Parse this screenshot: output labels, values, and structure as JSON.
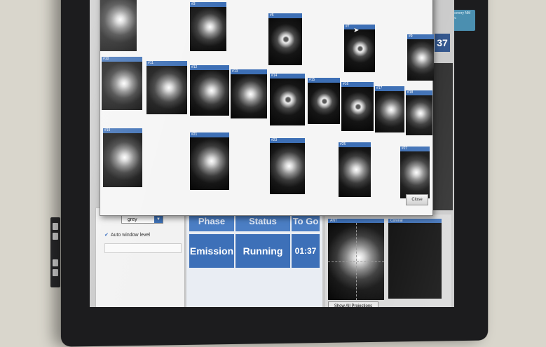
{
  "monitor": {
    "brand_badge": "Discovery NM 530c"
  },
  "background_app": {
    "colormap_select": "grey",
    "auto_window_level_label": "Auto window level",
    "side_counter": "37",
    "status_table": {
      "headers": [
        "Phase",
        "Status",
        "To Go"
      ],
      "row": [
        "Emission",
        "Running",
        "01:37"
      ]
    },
    "views": [
      "ANT",
      "Coronal"
    ],
    "show_projections_button": "Show All Projections"
  },
  "projections_dialog": {
    "tiles": [
      {
        "label": "#3",
        "style": "blob"
      },
      {
        "label": "#5",
        "style": "ring"
      },
      {
        "label": "#7",
        "style": "ring"
      },
      {
        "label": "#9",
        "style": "blob"
      },
      {
        "label": "#10",
        "style": "blob"
      },
      {
        "label": "#11",
        "style": "blob"
      },
      {
        "label": "#12",
        "style": "blob"
      },
      {
        "label": "#13",
        "style": "blob"
      },
      {
        "label": "#14",
        "style": "ring"
      },
      {
        "label": "#15",
        "style": "ring"
      },
      {
        "label": "#16",
        "style": "ring"
      },
      {
        "label": "#17",
        "style": "blob"
      },
      {
        "label": "#18",
        "style": "blob"
      },
      {
        "label": "#19",
        "style": "blob"
      },
      {
        "label": "#21",
        "style": "blob"
      },
      {
        "label": "#23",
        "style": "blob"
      },
      {
        "label": "#25",
        "style": "blob"
      },
      {
        "label": "#27",
        "style": "blob"
      }
    ],
    "close_button": "Close"
  }
}
